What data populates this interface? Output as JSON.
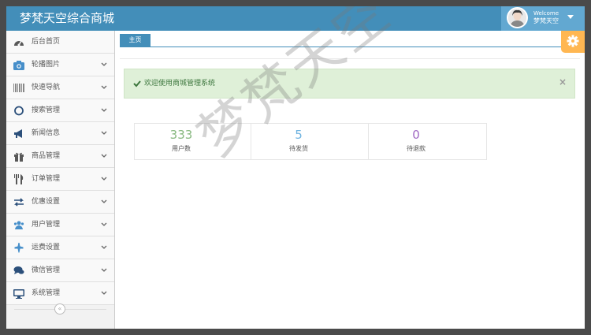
{
  "header": {
    "brand": "梦梵天空综合商城",
    "welcome": "Welcome",
    "username": "梦梵天空"
  },
  "sidebar": {
    "items": [
      {
        "label": "后台首页",
        "icon": "dashboard-icon",
        "has_arrow": false
      },
      {
        "label": "轮播图片",
        "icon": "camera-icon",
        "has_arrow": true
      },
      {
        "label": "快速导航",
        "icon": "barcode-icon",
        "has_arrow": true
      },
      {
        "label": "搜索管理",
        "icon": "circle-icon",
        "has_arrow": true
      },
      {
        "label": "新闻信息",
        "icon": "bullhorn-icon",
        "has_arrow": true
      },
      {
        "label": "商品管理",
        "icon": "gift-icon",
        "has_arrow": true
      },
      {
        "label": "订单管理",
        "icon": "cutlery-icon",
        "has_arrow": true
      },
      {
        "label": "优惠设置",
        "icon": "exchange-icon",
        "has_arrow": true
      },
      {
        "label": "用户管理",
        "icon": "users-icon",
        "has_arrow": true
      },
      {
        "label": "运费设置",
        "icon": "plane-icon",
        "has_arrow": true
      },
      {
        "label": "微信管理",
        "icon": "comments-icon",
        "has_arrow": true
      },
      {
        "label": "系统管理",
        "icon": "desktop-icon",
        "has_arrow": true
      }
    ],
    "collapse_glyph": "«"
  },
  "main": {
    "tab_home": "主页",
    "alert": {
      "text": "欢迎使用商城管理系统",
      "close": "×"
    },
    "stats": [
      {
        "value": "333",
        "label": "用户数",
        "color": "#87b87f"
      },
      {
        "value": "5",
        "label": "待发货",
        "color": "#6fb3e0"
      },
      {
        "value": "0",
        "label": "待退款",
        "color": "#a069c3"
      }
    ]
  },
  "watermark": "梦梵天空",
  "colors": {
    "topbar": "#438eb9",
    "user_box": "#62a8d1",
    "alert_bg": "#dff0d8",
    "alert_text": "#3c763d",
    "settings": "#ffb752",
    "icon_blue": "#478fca"
  }
}
